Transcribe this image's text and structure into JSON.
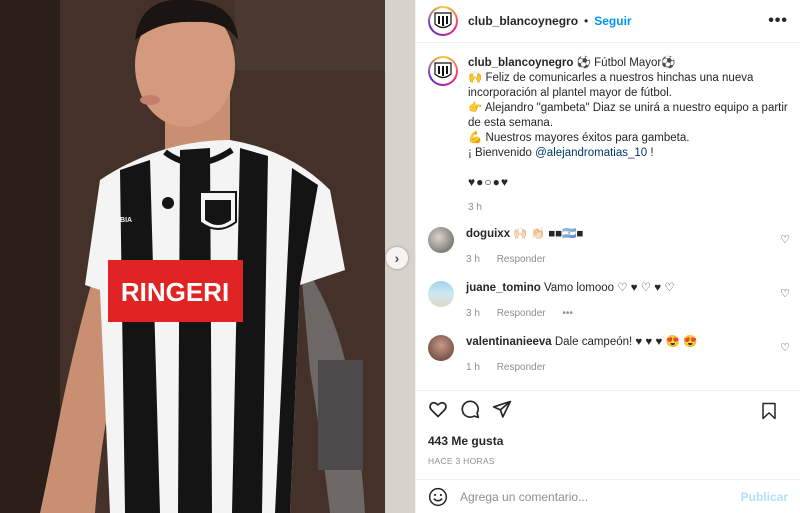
{
  "post": {
    "username": "club_blancoynegro",
    "follow_label": "Seguir",
    "more_label": "•••",
    "separator": "•"
  },
  "photo": {
    "sponsor_text": "RINGERI",
    "brand_text": "ACBIA",
    "next_arrow": "›",
    "colors": {
      "stripe_white": "#f4f4f4",
      "stripe_black": "#141414",
      "sponsor_red": "#e02424"
    }
  },
  "caption": {
    "username": "club_blancoynegro",
    "lines": [
      "⚽ Fútbol Mayor⚽",
      "🙌 Feliz de comunicarles a nuestros hinchas una nueva incorporación al plantel mayor de fútbol.",
      "👉 Alejandro \"gambeta\" Diaz se unirá a nuestro equipo a partir de esta semana.",
      "💪 Nuestros mayores éxitos para gambeta.",
      "¡ Bienvenido "
    ],
    "mention": "@alejandromatias_10",
    "mention_suffix": " !",
    "hearts": "♥●○●♥",
    "time": "3 h"
  },
  "comments": [
    {
      "username": "doguixx",
      "text": "🙌🏻 👏🏻 ■■🇦🇷■",
      "time": "3 h",
      "reply": "Responder",
      "extra": ""
    },
    {
      "username": "juane_tomino",
      "text": "Vamo lomooo ♡ ♥ ♡ ♥ ♡",
      "time": "3 h",
      "reply": "Responder",
      "extra": "•••"
    },
    {
      "username": "valentinanieeva",
      "text": "Dale campeón! ♥ ♥ ♥ 😍 😍",
      "time": "1 h",
      "reply": "Responder",
      "extra": ""
    }
  ],
  "footer": {
    "likes": "443 Me gusta",
    "posted": "HACE 3 HORAS",
    "comment_placeholder": "Agrega un comentario...",
    "publish_label": "Publicar"
  }
}
